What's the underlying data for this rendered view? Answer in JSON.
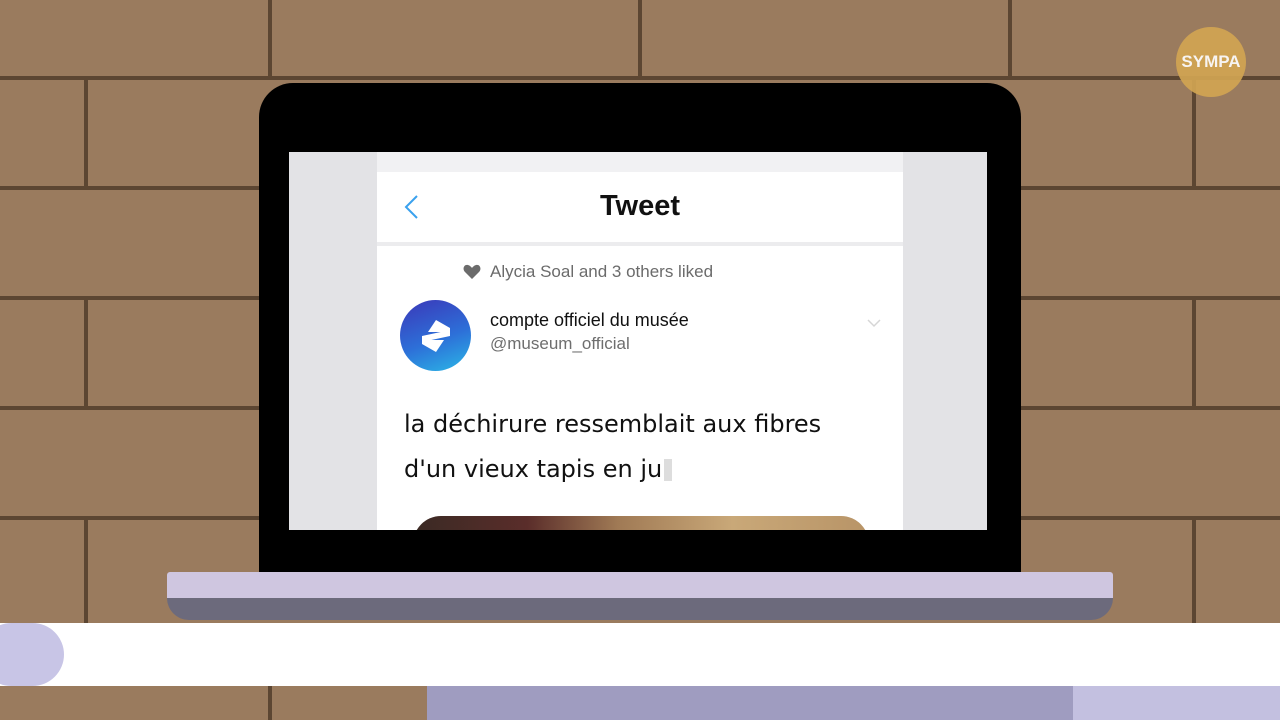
{
  "badge": {
    "text": "SYMPA"
  },
  "tweet_page": {
    "title": "Tweet",
    "social_context": "Alycia Soal and 3 others liked",
    "account": {
      "display_name": "compte officiel du musée",
      "handle": "@museum_official"
    },
    "text_lines": [
      "la déchirure ressemblait aux fibres",
      "d'un vieux tapis en ju"
    ]
  },
  "icons": {
    "back": "chevron-left-icon",
    "like": "heart-icon",
    "avatar_logo": "museum-logo-icon",
    "menu": "chevron-down-icon"
  },
  "colors": {
    "brick": "#9a7b5e",
    "mortar": "#5c4632",
    "badge": "#d2a553",
    "back_icon": "#3aa1ee",
    "avatar_gradient_start": "#3b37b8",
    "avatar_gradient_end": "#2bb7e6"
  }
}
